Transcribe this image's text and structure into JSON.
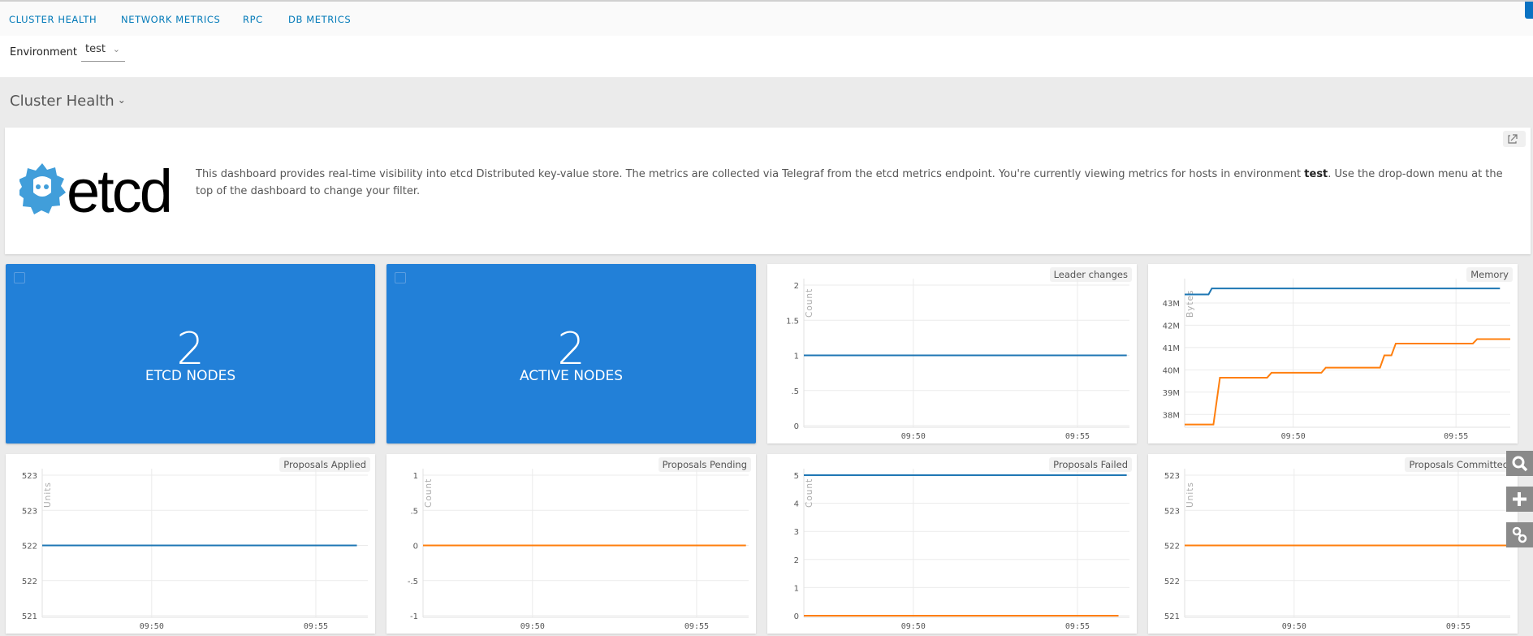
{
  "nav": {
    "tabs": [
      "CLUSTER HEALTH",
      "NETWORK METRICS",
      "RPC",
      "DB METRICS"
    ]
  },
  "filter": {
    "label": "Environment",
    "value": "test"
  },
  "section": {
    "title": "Cluster Health"
  },
  "info": {
    "logo_text": "etcd",
    "text_before": "This dashboard provides real-time visibility into etcd Distributed key-value store. The metrics are collected via Telegraf from the etcd metrics endpoint. You're currently viewing metrics for hosts in environment ",
    "env": "test",
    "text_after": ". Use the drop-down menu at the top of the dashboard to change your filter."
  },
  "tiles": [
    {
      "value": "2",
      "label": "ETCD NODES"
    },
    {
      "value": "2",
      "label": "ACTIVE NODES"
    }
  ],
  "colors": {
    "blue": "#1f77b4",
    "orange": "#ff7f0e",
    "grey": "#9a9a9a",
    "tile": "#2280d8",
    "nav": "#0079b8"
  },
  "chart_data": [
    {
      "type": "line",
      "title": "Leader changes",
      "ylabel": "Count",
      "ylim": [
        0,
        2
      ],
      "yticks": [
        0,
        0.5,
        1,
        1.5,
        2
      ],
      "ytick_labels": [
        "0",
        ".5",
        "1",
        "1.5",
        "2"
      ],
      "xlim": [
        "09:46:40",
        "09:56:35"
      ],
      "xticks": [
        "09:50",
        "09:55"
      ],
      "series": [
        {
          "color": "#9a9a9a",
          "x": [
            "09:46:40",
            "09:56:30"
          ],
          "y": [
            1,
            1
          ]
        },
        {
          "color": "#1f77b4",
          "x": [
            "09:46:40",
            "09:56:30"
          ],
          "y": [
            1,
            1
          ]
        }
      ]
    },
    {
      "type": "line",
      "title": "Memory",
      "ylabel": "Bytes",
      "ylim": [
        37.5,
        43.8
      ],
      "yticks": [
        38,
        39,
        40,
        41,
        42,
        43
      ],
      "ytick_labels": [
        "38M",
        "39M",
        "40M",
        "41M",
        "42M",
        "43M"
      ],
      "xlim": [
        "09:46:40",
        "09:56:40"
      ],
      "xticks": [
        "09:50",
        "09:55"
      ],
      "series": [
        {
          "color": "#1f77b4",
          "x": [
            "09:46:40",
            "09:47:24",
            "09:47:30",
            "09:56:21"
          ],
          "y": [
            43.38,
            43.38,
            43.65,
            43.65
          ]
        },
        {
          "color": "#ff7f0e",
          "x": [
            "09:46:40",
            "09:47:33",
            "09:47:45",
            "09:49:12",
            "09:49:20",
            "09:50:52",
            "09:51:00",
            "09:52:40",
            "09:52:48",
            "09:53:01",
            "09:53:09",
            "09:55:31",
            "09:55:39",
            "09:56:40"
          ],
          "y": [
            37.55,
            37.55,
            39.65,
            39.65,
            39.87,
            39.87,
            40.1,
            40.1,
            40.65,
            40.65,
            41.18,
            41.18,
            41.38,
            41.38
          ]
        }
      ]
    },
    {
      "type": "line",
      "title": "Proposals Applied",
      "ylabel": "Units",
      "ylim": [
        521,
        523
      ],
      "yticks": [
        521,
        521.5,
        522,
        522.5,
        523
      ],
      "ytick_labels": [
        "521",
        "522",
        "522",
        "523",
        "523"
      ],
      "xlim": [
        "09:46:40",
        "09:56:35"
      ],
      "xticks": [
        "09:50",
        "09:55"
      ],
      "series": [
        {
          "color": "#9a9a9a",
          "x": [
            "09:46:40",
            "09:56:15"
          ],
          "y": [
            522,
            522
          ]
        },
        {
          "color": "#1f77b4",
          "x": [
            "09:46:40",
            "09:56:15"
          ],
          "y": [
            522,
            522
          ]
        }
      ]
    },
    {
      "type": "line",
      "title": "Proposals Pending",
      "ylabel": "Count",
      "ylim": [
        -1,
        1
      ],
      "yticks": [
        -1,
        -0.5,
        0,
        0.5,
        1
      ],
      "ytick_labels": [
        "-1",
        "-.5",
        "0",
        ".5",
        "1"
      ],
      "xlim": [
        "09:46:40",
        "09:56:35"
      ],
      "xticks": [
        "09:50",
        "09:55"
      ],
      "series": [
        {
          "color": "#9a9a9a",
          "x": [
            "09:46:40",
            "09:56:30"
          ],
          "y": [
            0,
            0
          ]
        },
        {
          "color": "#ff7f0e",
          "x": [
            "09:46:40",
            "09:56:30"
          ],
          "y": [
            0,
            0
          ]
        }
      ]
    },
    {
      "type": "line",
      "title": "Proposals Failed",
      "ylabel": "Count",
      "ylim": [
        0,
        5
      ],
      "yticks": [
        0,
        1,
        2,
        3,
        4,
        5
      ],
      "ytick_labels": [
        "0",
        "1",
        "2",
        "3",
        "4",
        "5"
      ],
      "xlim": [
        "09:46:40",
        "09:56:35"
      ],
      "xticks": [
        "09:50",
        "09:55"
      ],
      "series": [
        {
          "color": "#1f77b4",
          "x": [
            "09:46:40",
            "09:56:30"
          ],
          "y": [
            5,
            5
          ]
        },
        {
          "color": "#ff7f0e",
          "x": [
            "09:46:40",
            "09:56:15"
          ],
          "y": [
            0,
            0
          ]
        }
      ]
    },
    {
      "type": "line",
      "title": "Proposals Committed",
      "ylabel": "Units",
      "ylim": [
        521,
        523
      ],
      "yticks": [
        521,
        521.5,
        522,
        522.5,
        523
      ],
      "ytick_labels": [
        "521",
        "522",
        "522",
        "523",
        "523"
      ],
      "xlim": [
        "09:46:40",
        "09:56:35"
      ],
      "xticks": [
        "09:50",
        "09:55"
      ],
      "series": [
        {
          "color": "#9a9a9a",
          "x": [
            "09:46:40",
            "09:56:35"
          ],
          "y": [
            522,
            522
          ]
        },
        {
          "color": "#ff7f0e",
          "x": [
            "09:46:40",
            "09:56:35"
          ],
          "y": [
            522,
            522
          ]
        }
      ]
    }
  ],
  "floating": {
    "buttons": [
      "search-icon",
      "plus-icon",
      "link-icon"
    ]
  }
}
